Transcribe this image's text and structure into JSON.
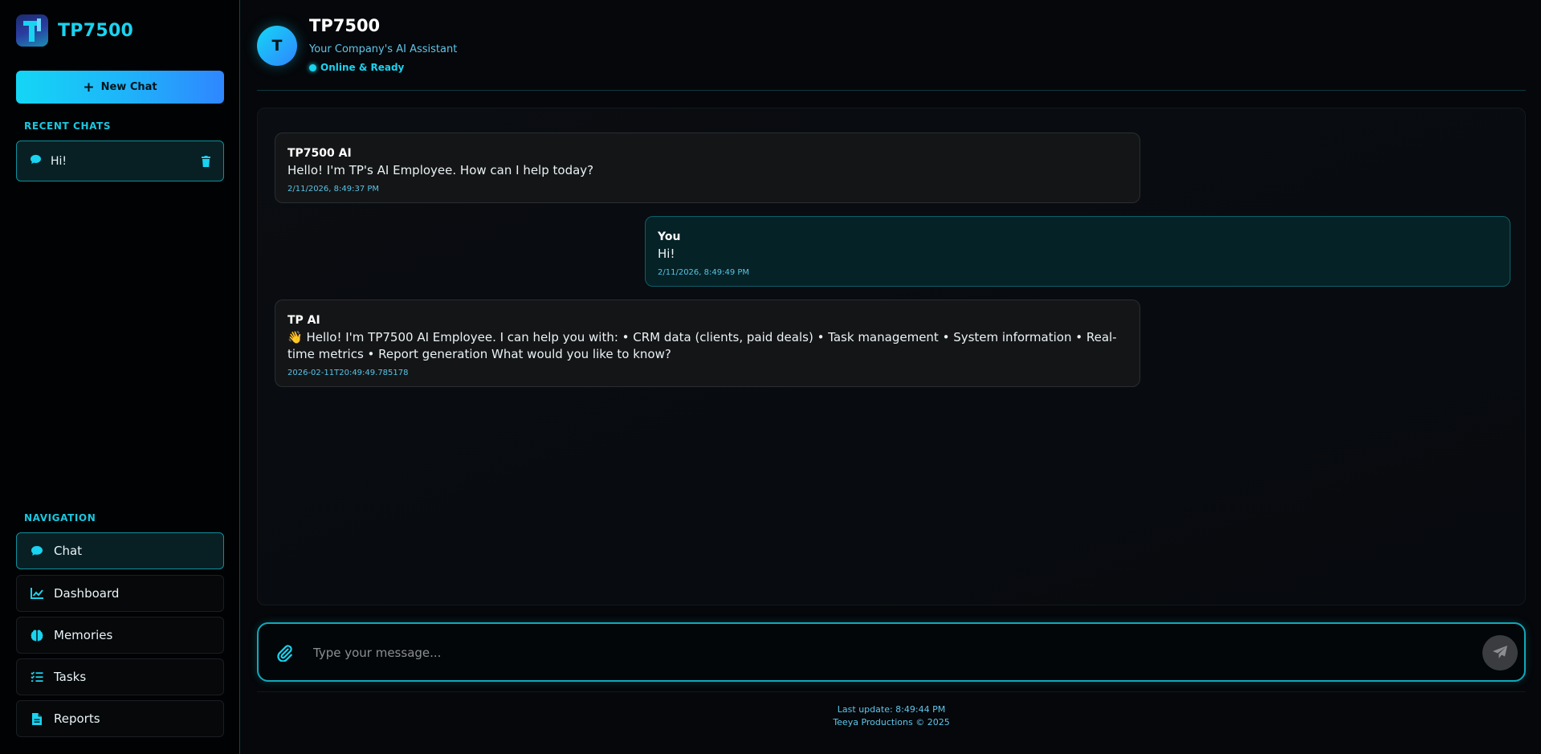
{
  "brand": {
    "name": "TP7500"
  },
  "sidebar": {
    "new_chat_label": "New Chat",
    "recent_chats_label": "RECENT CHATS",
    "recent_chats": [
      {
        "label": "Hi!"
      }
    ],
    "navigation_label": "NAVIGATION",
    "nav_items": [
      {
        "label": "Chat",
        "icon": "chat-bubble-icon",
        "active": true
      },
      {
        "label": "Dashboard",
        "icon": "line-chart-icon",
        "active": false
      },
      {
        "label": "Memories",
        "icon": "brain-icon",
        "active": false
      },
      {
        "label": "Tasks",
        "icon": "checklist-icon",
        "active": false
      },
      {
        "label": "Reports",
        "icon": "file-icon",
        "active": false
      }
    ]
  },
  "header": {
    "avatar_letter": "T",
    "title": "TP7500",
    "subtitle": "Your Company's AI Assistant",
    "status": "Online & Ready"
  },
  "messages": [
    {
      "role": "ai",
      "sender": "TP7500 AI",
      "text": "Hello! I'm TP's AI Employee. How can I help today?",
      "time": "2/11/2026, 8:49:37 PM"
    },
    {
      "role": "user",
      "sender": "You",
      "text": "Hi!",
      "time": "2/11/2026, 8:49:49 PM"
    },
    {
      "role": "ai",
      "sender": "TP AI",
      "text": "👋 Hello! I'm TP7500 AI Employee. I can help you with: • CRM data (clients, paid deals) • Task management • System information • Real-time metrics • Report generation What would you like to know?",
      "time": "2026-02-11T20:49:49.785178"
    }
  ],
  "composer": {
    "placeholder": "Type your message...",
    "value": ""
  },
  "footer": {
    "last_update": "Last update: 8:49:44 PM",
    "copyright": "Teeya Productions © 2025"
  },
  "colors": {
    "accent": "#19d3f0",
    "accent_blue": "#2f86ff",
    "background": "#05070a",
    "user_bubble": "#052226",
    "ai_bubble": "#141517"
  }
}
